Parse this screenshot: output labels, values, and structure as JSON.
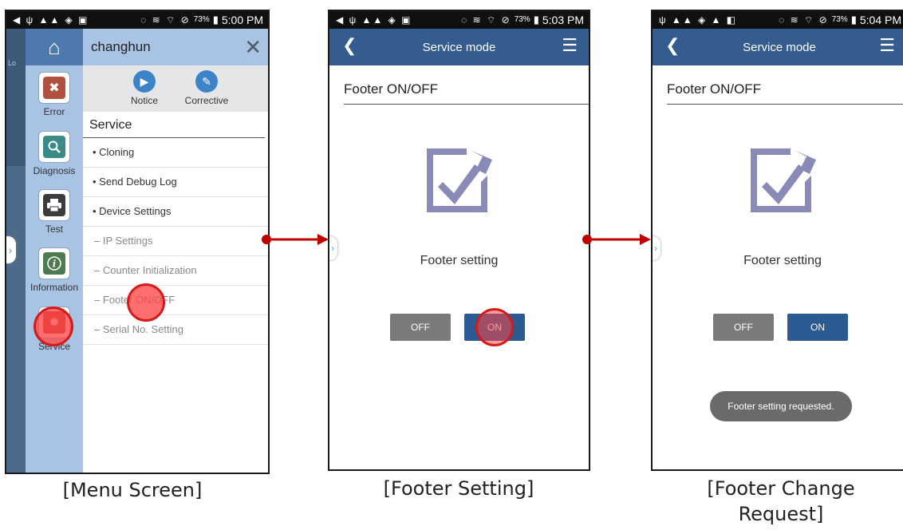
{
  "screens": {
    "menu": {
      "status": {
        "battery": "73%",
        "time": "5:00 PM"
      },
      "bg_partial_text": "Lo",
      "user_name": "changhun",
      "quick_actions": [
        {
          "label": "Notice",
          "icon": "play-icon"
        },
        {
          "label": "Corrective",
          "icon": "edit-icon"
        }
      ],
      "rail": [
        {
          "label": "Error",
          "icon": "error-icon",
          "color": "#b0513f"
        },
        {
          "label": "Diagnosis",
          "icon": "search-icon",
          "color": "#3a8a87"
        },
        {
          "label": "Test",
          "icon": "printer-icon",
          "color": "#3c3c3c"
        },
        {
          "label": "Information",
          "icon": "info-icon",
          "color": "#4e7a52"
        },
        {
          "label": "Service",
          "icon": "gear-icon",
          "color": "#b53a3a"
        }
      ],
      "section_title": "Service",
      "items": [
        "• Cloning",
        "• Send Debug Log",
        "• Device Settings",
        "– IP Settings",
        "– Counter Initialization",
        "– Footer ON/OFF",
        "– Serial No. Setting"
      ],
      "caption": "[Menu Screen]"
    },
    "footer_setting": {
      "status": {
        "battery": "73%",
        "time": "5:03 PM"
      },
      "title": "Service mode",
      "screen_title": "Footer ON/OFF",
      "label": "Footer setting",
      "off_label": "OFF",
      "on_label": "ON",
      "caption": "[Footer Setting]"
    },
    "footer_request": {
      "status": {
        "battery": "73%",
        "time": "5:04 PM"
      },
      "title": "Service mode",
      "screen_title": "Footer ON/OFF",
      "label": "Footer setting",
      "off_label": "OFF",
      "on_label": "ON",
      "toast": "Footer setting requested.",
      "caption_line1": "[Footer Change",
      "caption_line2": "Request]"
    }
  },
  "colors": {
    "header_blue": "#345c8f",
    "rail_blue": "#a8c3e3",
    "touch_red": "#d51a1a",
    "arrow_red": "#c00000",
    "icon_purple": "#8a8ab8"
  }
}
